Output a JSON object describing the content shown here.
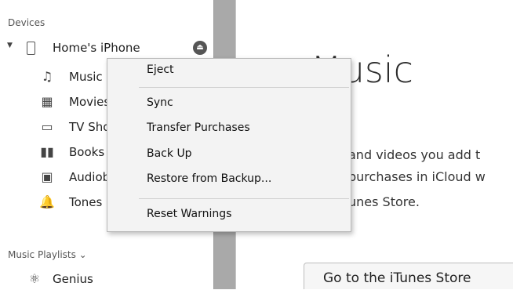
{
  "sidebar": {
    "devices_header": "Devices",
    "device": {
      "name": "Home's iPhone",
      "disclosure_glyph": "▼",
      "eject_glyph": "⏏"
    },
    "items": [
      {
        "label": "Music",
        "icon": "music-note-icon",
        "glyph": "♫"
      },
      {
        "label": "Movies",
        "icon": "film-icon",
        "glyph": "▦"
      },
      {
        "label": "TV Shows",
        "icon": "tv-icon",
        "glyph": "▭"
      },
      {
        "label": "Books",
        "icon": "book-icon",
        "glyph": "▮▮"
      },
      {
        "label": "Audiobooks",
        "icon": "audiobook-icon",
        "glyph": "▣"
      },
      {
        "label": "Tones",
        "icon": "bell-icon",
        "glyph": "🔔"
      }
    ],
    "playlists_header": "Music Playlists ⌄",
    "genius": {
      "label": "Genius",
      "icon": "genius-atom-icon",
      "glyph": "⚛"
    }
  },
  "main": {
    "title": "Music",
    "line1": "and videos you add t",
    "line2": "purchases in iCloud w",
    "line3": "unes Store.",
    "store_button": "Go to the iTunes Store"
  },
  "context_menu": {
    "items": [
      "Eject",
      "Sync",
      "Transfer Purchases",
      "Back Up",
      "Restore from Backup...",
      "Reset Warnings"
    ]
  }
}
